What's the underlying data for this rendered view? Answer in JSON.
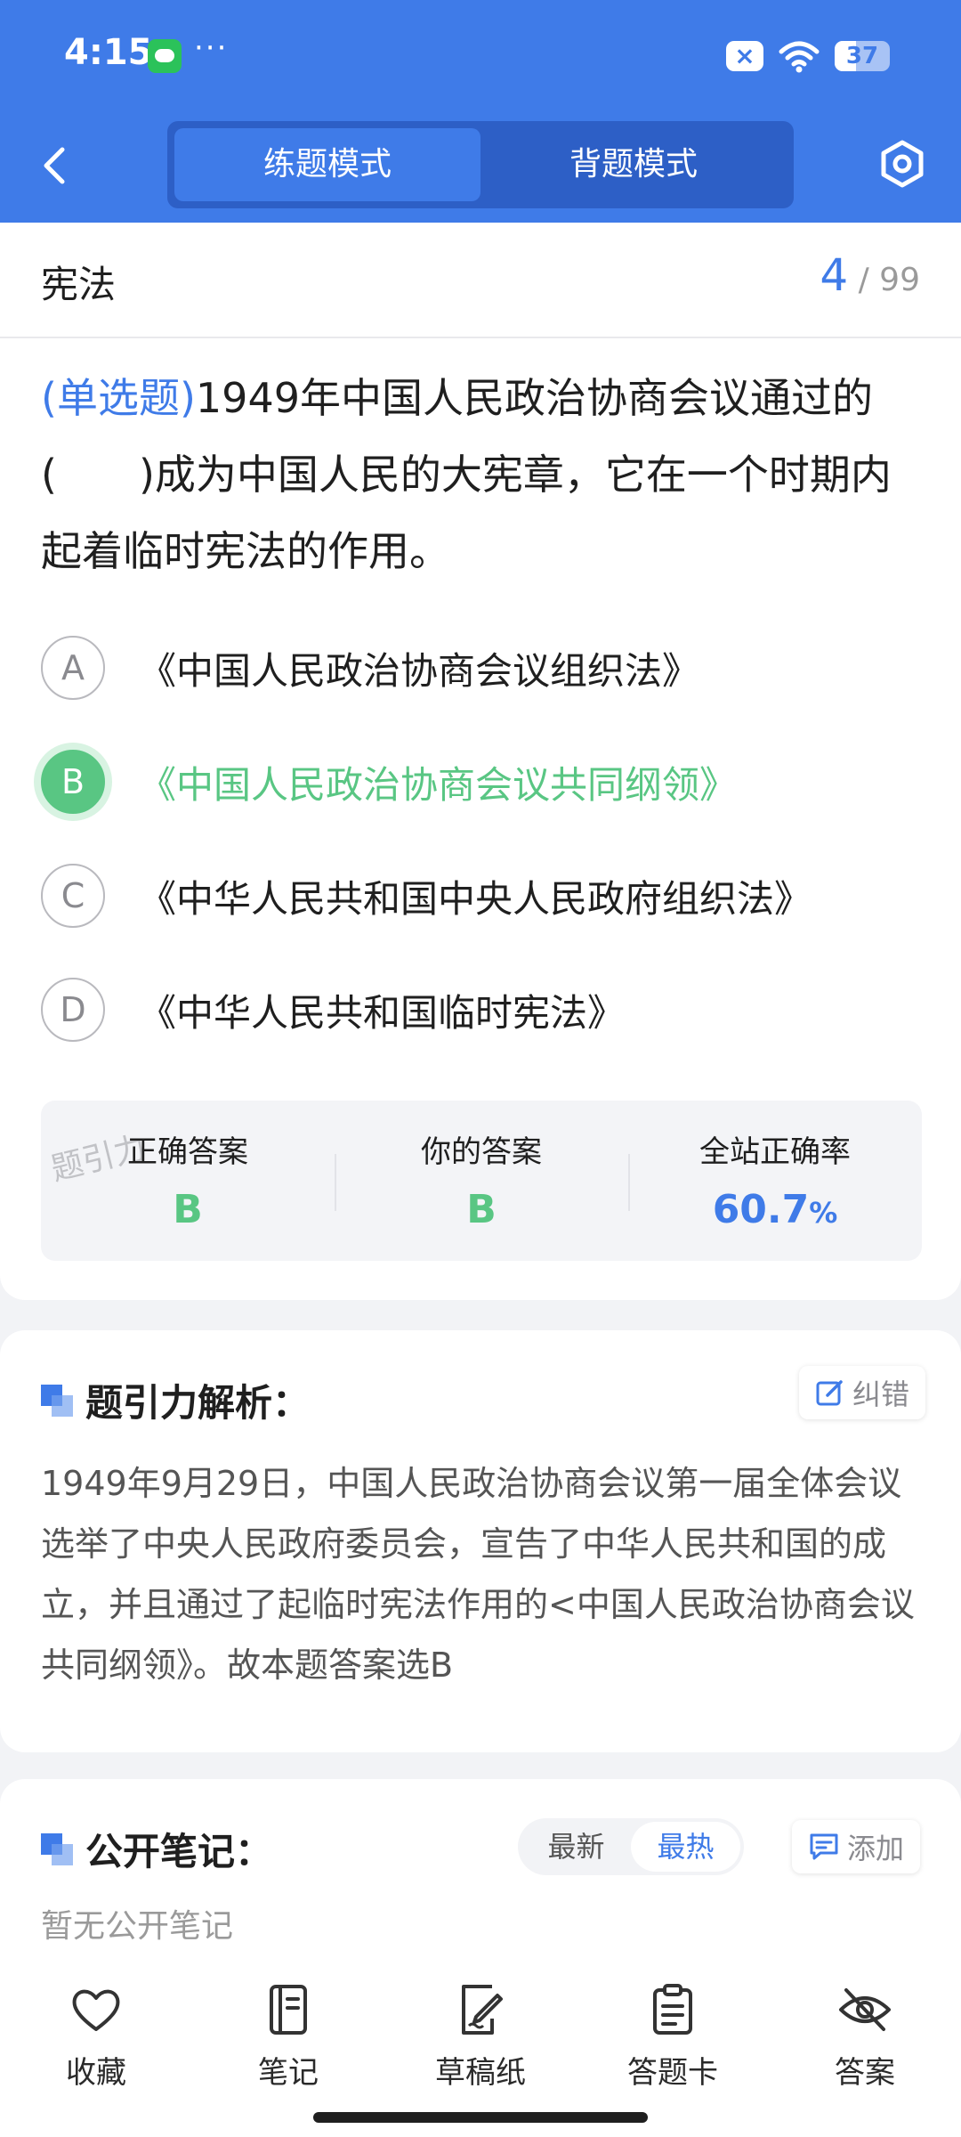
{
  "status_bar": {
    "time": "4:15",
    "dots": "···",
    "battery": "37"
  },
  "header": {
    "tabs": [
      {
        "label": "练题模式",
        "active": true
      },
      {
        "label": "背题模式",
        "active": false
      }
    ]
  },
  "subject": {
    "name": "宪法",
    "current": "4",
    "total": "/ 99"
  },
  "question": {
    "type_label": "(单选题)",
    "text": "1949年中国人民政治协商会议通过的(　　)成为中国人民的大宪章，它在一个时期内起着临时宪法的作用。"
  },
  "options": [
    {
      "letter": "A",
      "text": "《中国人民政治协商会议组织法》",
      "state": "normal"
    },
    {
      "letter": "B",
      "text": "《中国人民政治协商会议共同纲领》",
      "state": "correct"
    },
    {
      "letter": "C",
      "text": "《中华人民共和国中央人民政府组织法》",
      "state": "normal"
    },
    {
      "letter": "D",
      "text": "《中华人民共和国临时宪法》",
      "state": "normal"
    }
  ],
  "stats": {
    "watermark": "题引力",
    "correct_label": "正确答案",
    "correct_value": "B",
    "yours_label": "你的答案",
    "yours_value": "B",
    "rate_label": "全站正确率",
    "rate_value": "60.7",
    "rate_unit": "%"
  },
  "analysis": {
    "title": "题引力解析：",
    "report_label": "纠错",
    "text": "1949年9月29日，中国人民政治协商会议第一届全体会议选举了中央人民政府委员会，宣告了中华人民共和国的成立，并且通过了起临时宪法作用的<中国人民政治协商会议共同纲领》。故本题答案选B"
  },
  "notes": {
    "title": "公开笔记：",
    "sort_tabs": [
      {
        "label": "最新",
        "active": false
      },
      {
        "label": "最热",
        "active": true
      }
    ],
    "add_label": "添加",
    "empty_text": "暂无公开笔记"
  },
  "bottom_bar": {
    "items": [
      {
        "label": "收藏",
        "icon": "heart-icon"
      },
      {
        "label": "笔记",
        "icon": "notebook-icon"
      },
      {
        "label": "草稿纸",
        "icon": "draft-paper-icon"
      },
      {
        "label": "答题卡",
        "icon": "answer-card-icon"
      },
      {
        "label": "答案",
        "icon": "eye-off-icon"
      }
    ]
  },
  "colors": {
    "brand": "#3f7be8",
    "correct": "#59c683"
  }
}
